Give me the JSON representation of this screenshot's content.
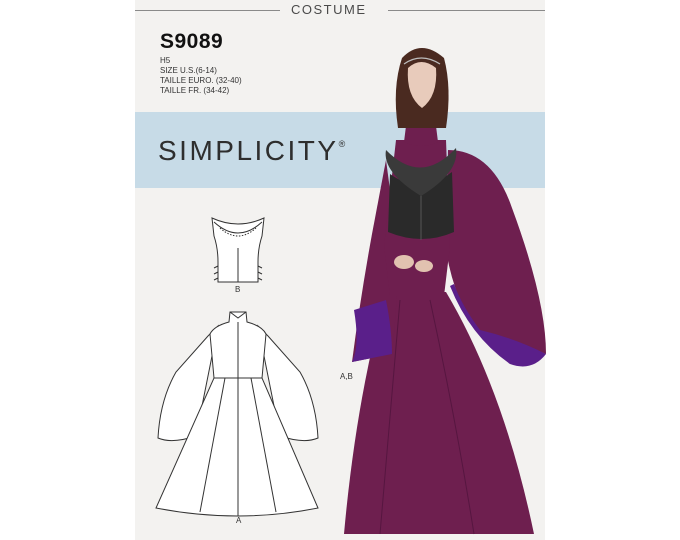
{
  "header": {
    "category": "COSTUME"
  },
  "pattern": {
    "number": "S9089",
    "size_code": "H5",
    "size_us": "SIZE U.S.(6-14)",
    "size_euro": "TAILLE EURO. (32-40)",
    "size_fr": "TAILLE FR. (34-42)"
  },
  "brand": {
    "name": "SIMPLICITY",
    "mark": "®"
  },
  "views": {
    "bodice_label": "B",
    "gown_label": "A",
    "photo_label": "A,B"
  },
  "colors": {
    "band": "#c7dbe7",
    "envelope": "#f3f2f0",
    "gown": "#6e1f4f",
    "lining": "#5a1f8a",
    "bodice": "#2a2a2a"
  },
  "icons": {
    "bodice_view": "bodice-line-drawing",
    "gown_view": "gown-line-drawing",
    "model": "model-photo"
  }
}
